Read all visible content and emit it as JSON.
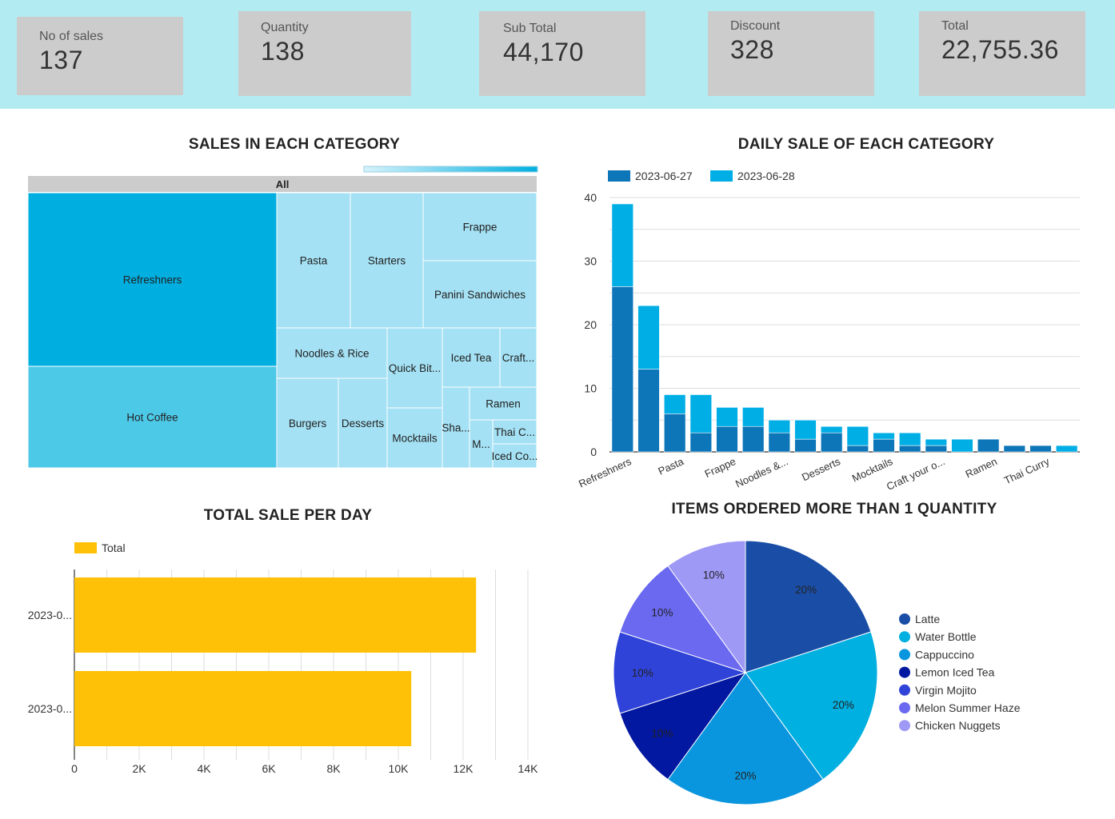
{
  "kpis": [
    {
      "label": "No of sales",
      "value": "137"
    },
    {
      "label": "Quantity",
      "value": "138"
    },
    {
      "label": "Sub Total",
      "value": "44,170"
    },
    {
      "label": "Discount",
      "value": "328"
    },
    {
      "label": "Total",
      "value": "22,755.36"
    }
  ],
  "colors": {
    "kpi_band": "#b3ebf2",
    "kpi_card": "#cccccc",
    "series_a": "#0d76b8",
    "series_b": "#00aee6",
    "total_bar": "#ffc107"
  },
  "treemap": {
    "title": "SALES IN EACH CATEGORY",
    "root_label": "All",
    "tiles": [
      {
        "label": "Refreshners",
        "color": "#00afe0"
      },
      {
        "label": "Hot Coffee",
        "color": "#4dc9e8"
      },
      {
        "label": "Pasta",
        "color": "#a4e1f4"
      },
      {
        "label": "Starters",
        "color": "#a4e1f4"
      },
      {
        "label": "Frappe",
        "color": "#a4e1f4"
      },
      {
        "label": "Panini Sandwiches",
        "color": "#a4e1f4"
      },
      {
        "label": "Noodles & Rice",
        "color": "#a4e1f4"
      },
      {
        "label": "Quick Bit...",
        "color": "#a4e1f4"
      },
      {
        "label": "Iced Tea",
        "color": "#a4e1f4"
      },
      {
        "label": "Craft...",
        "color": "#a4e1f4"
      },
      {
        "label": "Burgers",
        "color": "#a4e1f4"
      },
      {
        "label": "Desserts",
        "color": "#a4e1f4"
      },
      {
        "label": "Mocktails",
        "color": "#a4e1f4"
      },
      {
        "label": "Sha...",
        "color": "#a4e1f4"
      },
      {
        "label": "Ramen",
        "color": "#a4e1f4"
      },
      {
        "label": "M...",
        "color": "#a4e1f4"
      },
      {
        "label": "Thai C...",
        "color": "#a4e1f4"
      },
      {
        "label": "Iced Co...",
        "color": "#a4e1f4"
      }
    ]
  },
  "chart_data": [
    {
      "type": "bar",
      "stacked": true,
      "title": "DAILY SALE OF EACH CATEGORY",
      "series": [
        {
          "name": "2023-06-27",
          "color": "#0d76b8",
          "values": [
            26,
            13,
            6,
            3,
            4,
            4,
            3,
            2,
            3,
            1,
            2,
            1,
            1,
            0,
            2,
            1,
            1,
            0
          ]
        },
        {
          "name": "2023-06-28",
          "color": "#00aee6",
          "values": [
            13,
            10,
            3,
            6,
            3,
            3,
            2,
            3,
            1,
            3,
            1,
            2,
            1,
            2,
            0,
            0,
            0,
            1
          ]
        }
      ],
      "x_tick_labels": [
        "Refreshners",
        "Pasta",
        "Frappe",
        "Noodles &...",
        "Desserts",
        "Mocktails",
        "Craft your o...",
        "Ramen",
        "Thai Curry"
      ],
      "ylim": [
        0,
        40
      ],
      "yticks": [
        0,
        10,
        20,
        30,
        40
      ],
      "grid": true,
      "legend": "top-left"
    },
    {
      "type": "bar",
      "orientation": "horizontal",
      "title": "TOTAL SALE PER DAY",
      "categories": [
        "2023-0...",
        "2023-0..."
      ],
      "series": [
        {
          "name": "Total",
          "color": "#ffc107",
          "values": [
            12400,
            10400
          ]
        }
      ],
      "xlim": [
        0,
        14000
      ],
      "xtick_labels": [
        "0",
        "2K",
        "4K",
        "6K",
        "8K",
        "10K",
        "12K",
        "14K"
      ],
      "grid": true,
      "legend": "top-left"
    },
    {
      "type": "pie",
      "title": "ITEMS ORDERED MORE THAN 1 QUANTITY",
      "slices": [
        {
          "name": "Latte",
          "value": 20,
          "label": "20%",
          "color": "#1a4ea6"
        },
        {
          "name": "Water Bottle",
          "value": 20,
          "label": "20%",
          "color": "#00b0e0"
        },
        {
          "name": "Cappuccino",
          "value": 20,
          "label": "20%",
          "color": "#0a96de"
        },
        {
          "name": "Lemon Iced Tea",
          "value": 10,
          "label": "10%",
          "color": "#0318a0"
        },
        {
          "name": "Virgin Mojito",
          "value": 10,
          "label": "10%",
          "color": "#3043d8"
        },
        {
          "name": "Melon Summer Haze",
          "value": 10,
          "label": "10%",
          "color": "#6a69f0"
        },
        {
          "name": "Chicken Nuggets",
          "value": 10,
          "label": "10%",
          "color": "#9f99f6"
        }
      ],
      "legend": "right"
    }
  ]
}
